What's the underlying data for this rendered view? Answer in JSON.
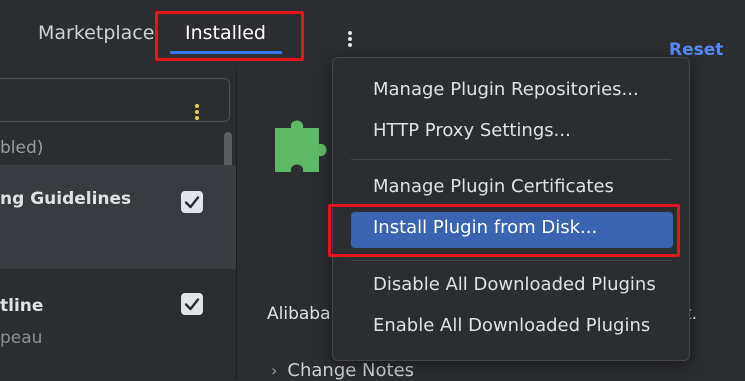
{
  "tabs": {
    "marketplace": "Marketplace",
    "installed": "Installed"
  },
  "header": {
    "reset": "Reset"
  },
  "plugin_list": {
    "partial_label": "bled)",
    "items": [
      {
        "name": "ng Guidelines",
        "subtitle": "",
        "enabled": true
      },
      {
        "name": "tline",
        "subtitle": "peau",
        "enabled": true
      }
    ]
  },
  "detail": {
    "description_start": "Alibaba",
    "description_end": "t.",
    "change_notes": "Change Notes"
  },
  "menu": {
    "items": [
      "Manage Plugin Repositories...",
      "HTTP Proxy Settings...",
      "Manage Plugin Certificates",
      "Install Plugin from Disk...",
      "Disable All Downloaded Plugins",
      "Enable All Downloaded Plugins"
    ],
    "selected_index": 3
  },
  "colors": {
    "accent": "#3574f0",
    "highlight": "#e3161c",
    "puzzle": "#5fb865",
    "selected": "#3a63b0"
  }
}
